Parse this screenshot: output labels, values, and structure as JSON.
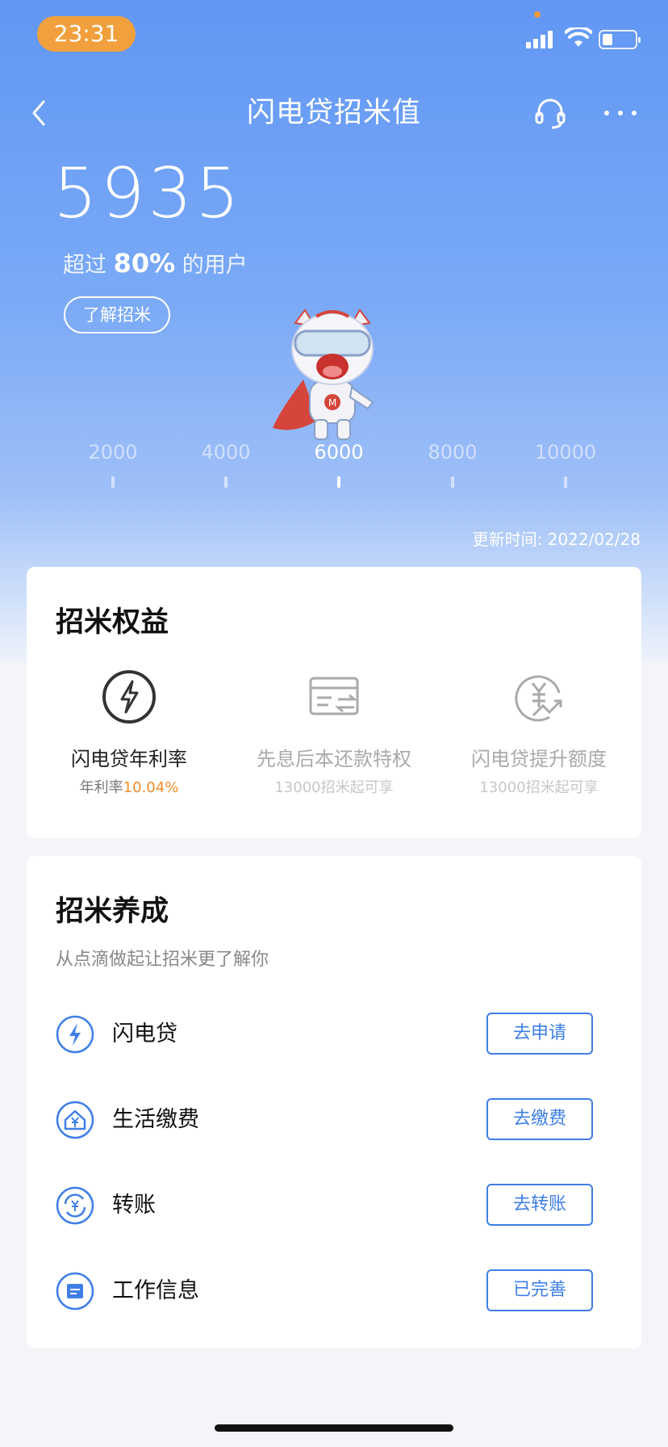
{
  "status": {
    "time": "23:31"
  },
  "nav": {
    "title": "闪电贷招米值"
  },
  "score": {
    "value": "5935",
    "exceed_prefix": "超过",
    "exceed_percent": "80%",
    "exceed_suffix": "的用户",
    "learn_button": "了解招米"
  },
  "scale": {
    "ticks": [
      "2000",
      "4000",
      "6000",
      "8000",
      "10000"
    ],
    "current": "6000"
  },
  "update": {
    "text": "更新时间: 2022/02/28"
  },
  "benefits": {
    "title": "招米权益",
    "items": [
      {
        "name": "闪电贷年利率",
        "sub_prefix": "年利率",
        "sub_value": "10.04%",
        "icon": "lightning-icon"
      },
      {
        "name": "先息后本还款特权",
        "sub": "13000招米起可享",
        "icon": "card-exchange-icon"
      },
      {
        "name": "闪电贷提升额度",
        "sub": "13000招米起可享",
        "icon": "yuan-growth-icon"
      }
    ]
  },
  "cultivate": {
    "title": "招米养成",
    "subtitle": "从点滴做起让招米更了解你",
    "tasks": [
      {
        "label": "闪电贷",
        "button": "去申请",
        "icon": "lightning-circle-icon"
      },
      {
        "label": "生活缴费",
        "button": "去缴费",
        "icon": "house-yuan-icon"
      },
      {
        "label": "转账",
        "button": "去转账",
        "icon": "transfer-icon"
      },
      {
        "label": "工作信息",
        "button": "已完善",
        "icon": "document-icon"
      }
    ]
  },
  "colors": {
    "primary": "#3f7fe6",
    "accent": "#f08c28",
    "header_top": "#6197f4"
  }
}
